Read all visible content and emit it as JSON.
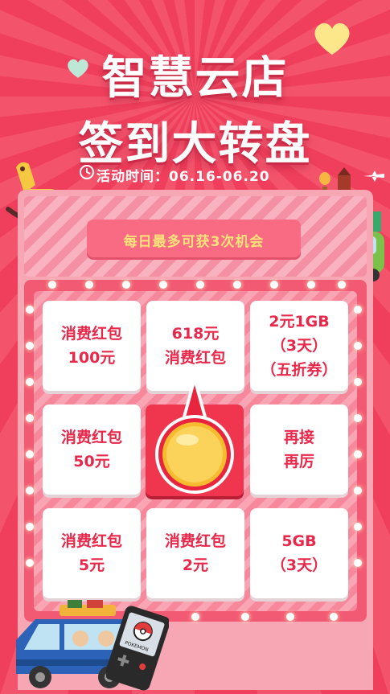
{
  "header": {
    "title_line1": "智慧云店",
    "title_line2": "签到大转盘",
    "activity_time": "活动时间：06.16-06.20"
  },
  "banner": {
    "text": "每日最多可获3次机会"
  },
  "grid": {
    "cells": [
      {
        "label": "消费红包\n100元"
      },
      {
        "label": "618元\n消费红包"
      },
      {
        "label": "2元1GB\n（3天）\n（五折券）"
      },
      {
        "label": "消费红包\n50元"
      },
      {
        "label": "再接\n再厉"
      },
      {
        "label": "消费红包\n5元"
      },
      {
        "label": "消费红包\n2元"
      },
      {
        "label": "5GB\n（3天）"
      }
    ]
  },
  "decorations": {
    "phone_text": "POKEMON"
  },
  "colors": {
    "background": "#f2445f",
    "prize_text": "#e8284a",
    "banner_text": "#ffe37a",
    "center_button": "#f0364f"
  }
}
